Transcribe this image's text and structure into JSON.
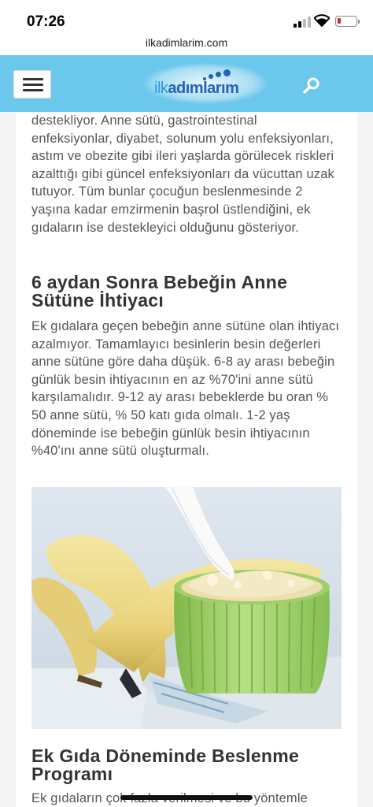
{
  "status_bar": {
    "time": "07:26",
    "battery_color": "#e0262b"
  },
  "browser": {
    "url": "ilkadimlarim.com"
  },
  "header": {
    "background": "#6cc7ec",
    "logo": {
      "text_light": "ilk",
      "text_bold": "adımlarım"
    },
    "menu_icon": "hamburger-icon",
    "search_icon": "search-icon"
  },
  "article": {
    "intro_paragraph": "destekliyor. Anne sütü, gastrointestinal enfeksiyonlar, diyabet, solunum yolu enfeksiyonları, astım ve obezite gibi ileri yaşlarda görülecek riskleri azalttığı gibi güncel enfeksiyonları da vücuttan uzak tutuyor. Tüm bunlar çocuğun beslenmesinde 2 yaşına kadar emzirmenin başrol üstlendiğini, ek gıdaların ise destekleyici olduğunu gösteriyor.",
    "heading_1": " 6 aydan Sonra Bebeğin Anne Sütüne İhtiyacı",
    "paragraph_2": "Ek gıdalara geçen bebeğin anne sütüne olan ihtiyacı azalmıyor. Tamamlayıcı besinlerin besin değerleri anne sütüne göre daha düşük. 6-8 ay arası bebeğin günlük besin ihtiyacının en az %70'ini anne sütü karşılamalıdır. 9-12 ay arası bebeklerde bu oran % 50 anne sütü, % 50 katı gıda olmalı. 1-2 yaş döneminde ise bebeğin günlük besin ihtiyacının %40'ını anne sütü oluşturmalı.",
    "heading_2": "Ek Gıda Döneminde Beslenme Programı",
    "paragraph_3": "Ek gıdaların çok fazla verilmesi ve bu yöntemle"
  }
}
